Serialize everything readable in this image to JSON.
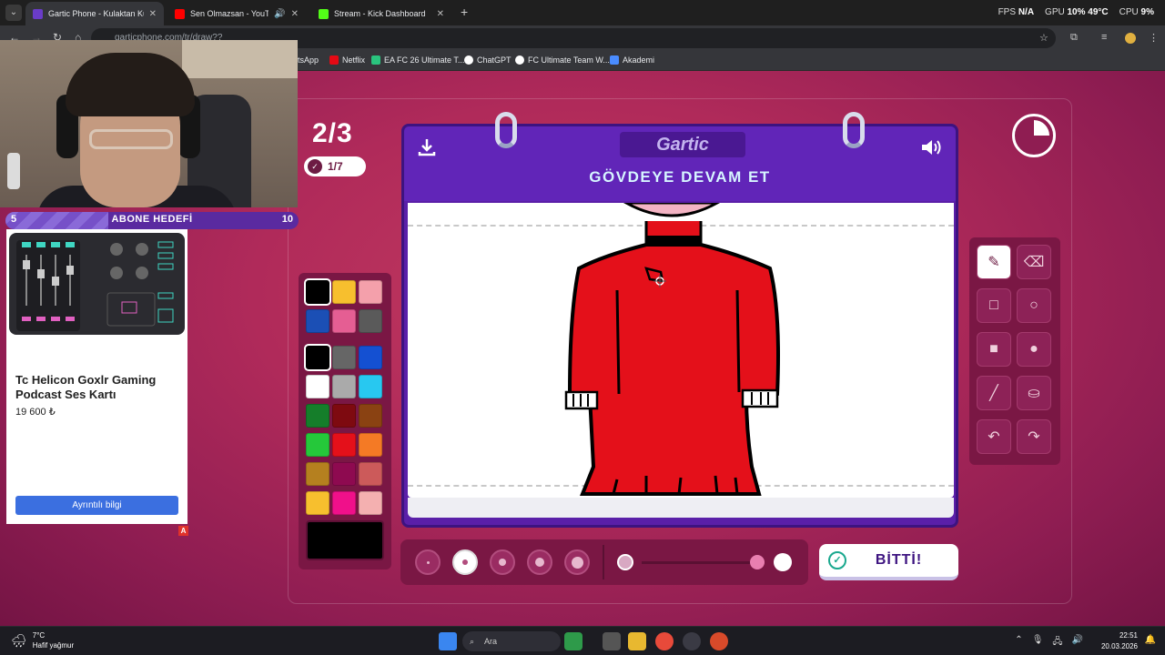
{
  "browser": {
    "tabs": [
      {
        "label": "Gartic Phone - Kulaktan Kulağa",
        "active": true,
        "color": "#6a3cc8"
      },
      {
        "label": "Sen Olmazsan - YouTube",
        "active": false,
        "color": "#ff0000"
      },
      {
        "label": "Stream - Kick Dashboard",
        "active": false,
        "color": "#53fc18"
      }
    ],
    "new_tab": "+",
    "url": "garticphone.com/tr/draw??",
    "perf": {
      "fps_label": "FPS",
      "fps": "N/A",
      "gpu_label": "GPU",
      "gpu": "10% 49°C",
      "cpu_label": "CPU",
      "cpu": "9%"
    },
    "bookmarks": [
      {
        "label": "tsApp",
        "color": "#25d366"
      },
      {
        "label": "Netflix",
        "color": "#e50914"
      },
      {
        "label": "EA FC 26 Ultimate T...",
        "color": "#2ac47e"
      },
      {
        "label": "ChatGPT",
        "color": "#ffffff"
      },
      {
        "label": "FC Ultimate Team W...",
        "color": "#ffffff"
      },
      {
        "label": "Akademi",
        "color": "#4a8cff"
      }
    ]
  },
  "game": {
    "round": "2/3",
    "progress": "1/7",
    "logo": "Gartic",
    "prompt": "GÖVDEYE DEVAM ET",
    "done_label": "BİTTİ!",
    "timer_fraction_elapsed": 0.25,
    "palette": [
      "#000000",
      "#f7bf2e",
      "#f4a0ab",
      "#1b4fb5",
      "#e55e93",
      "#5a5a5a",
      "#000000",
      "#666666",
      "#1450d2",
      "#ffffff",
      "#aaaaaa",
      "#28c8f0",
      "#157e2a",
      "#7e0a10",
      "#8a4212",
      "#25c83a",
      "#e4101a",
      "#f47a25",
      "#b5801f",
      "#8e0a50",
      "#cc5a5a",
      "#f7bf2e",
      "#f0108a",
      "#f4b0b0"
    ],
    "selected_color": "#000000",
    "tools": [
      "pencil-icon",
      "eraser-icon",
      "rectangle-outline-icon",
      "circle-outline-icon",
      "rectangle-fill-icon",
      "circle-fill-icon",
      "line-icon",
      "fill-bucket-icon",
      "undo-icon",
      "redo-icon"
    ],
    "brush_sizes": 5,
    "selected_brush": 1,
    "opacity_fraction": 0.9
  },
  "overlay": {
    "goal_start": "5",
    "goal_title": "ABONE HEDEFİ",
    "goal_end": "10",
    "goal_fraction": 0.35,
    "ad_title": "Tc Helicon Goxlr Gaming Podcast Ses Kartı",
    "ad_price": "19 600 ₺",
    "ad_button": "Ayrıntılı bilgi",
    "ad_badge": "A"
  },
  "taskbar": {
    "temp": "7°C",
    "weather": "Hafif yağmur",
    "search": "Ara",
    "time": "22:51",
    "date": "20.03.2026"
  }
}
